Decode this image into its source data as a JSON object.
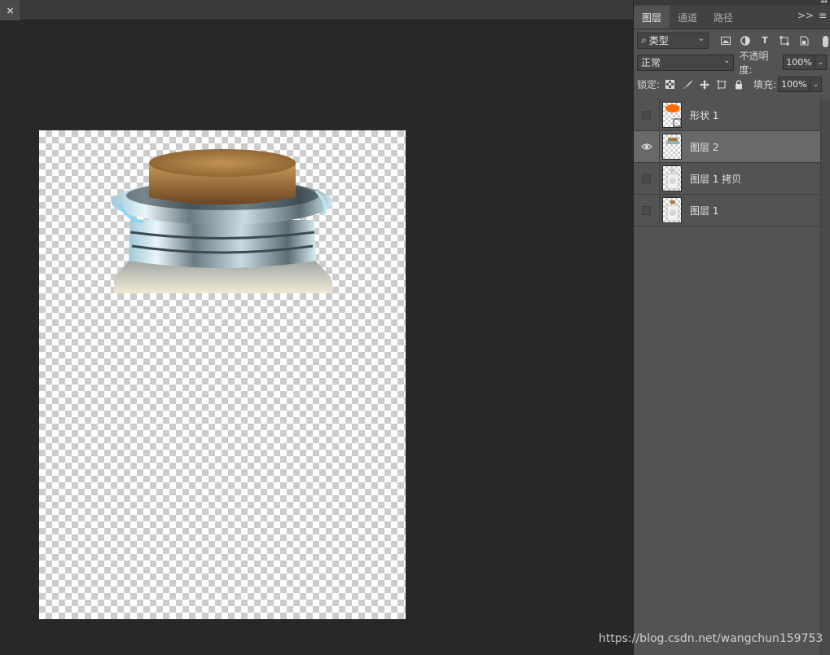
{
  "document": {
    "close_glyph": "×"
  },
  "panel": {
    "tabs": [
      {
        "label": "图层",
        "active": true
      },
      {
        "label": "通道",
        "active": false
      },
      {
        "label": "路径",
        "active": false
      }
    ],
    "menu_glyph": ">>",
    "filter": {
      "label": "类型",
      "search_glyph": "⌕"
    },
    "filter_icons": [
      "image-filter-icon",
      "adjustment-filter-icon",
      "type-filter-icon",
      "shape-filter-icon",
      "smart-object-filter-icon"
    ],
    "blend_mode": "正常",
    "opacity_label": "不透明度:",
    "opacity_value": "100%",
    "lock_label": "锁定:",
    "lock_icons": [
      "lock-transparent-pixels-icon",
      "lock-image-pixels-icon",
      "lock-position-icon",
      "prevent-autonest-icon",
      "lock-all-icon"
    ],
    "fill_label": "填充:",
    "fill_value": "100%",
    "layers": [
      {
        "name": "形状 1",
        "visible": false,
        "selected": false,
        "thumb": "shape"
      },
      {
        "name": "图层 2",
        "visible": true,
        "selected": true,
        "thumb": "cork"
      },
      {
        "name": "图层 1 拷贝",
        "visible": false,
        "selected": false,
        "thumb": "bottle"
      },
      {
        "name": "图层 1",
        "visible": false,
        "selected": false,
        "thumb": "bottle"
      }
    ]
  },
  "colors": {
    "shape_thumb": "#ff6a00",
    "canvas_bg": "#282828",
    "panel_bg": "#535353"
  },
  "watermark": "https://blog.csdn.net/wangchun159753"
}
